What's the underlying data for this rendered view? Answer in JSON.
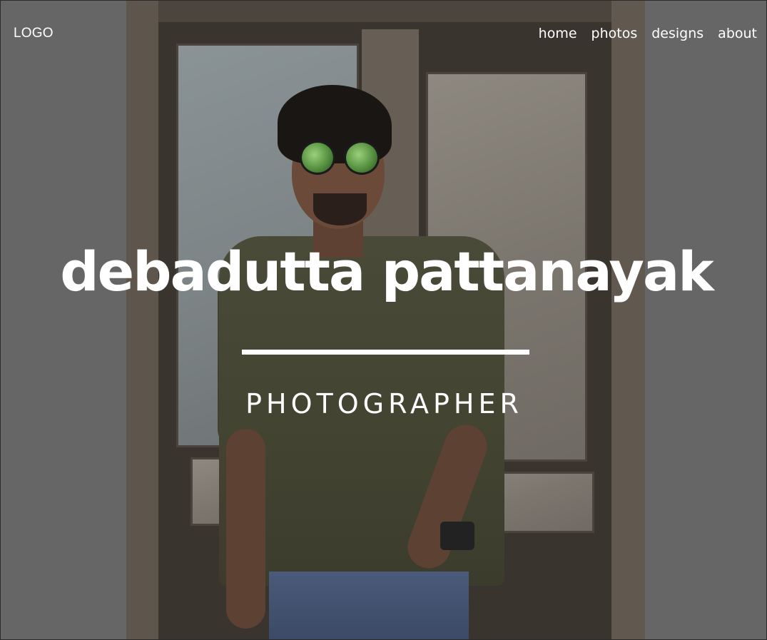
{
  "header": {
    "logo": "LOGO",
    "nav": [
      {
        "label": "home"
      },
      {
        "label": "photos"
      },
      {
        "label": "designs"
      },
      {
        "label": "about"
      }
    ]
  },
  "hero": {
    "name": "debadutta pattanayak",
    "role": "PHOTOGRAPHER"
  },
  "colors": {
    "background": "#666666",
    "text": "#ffffff"
  }
}
